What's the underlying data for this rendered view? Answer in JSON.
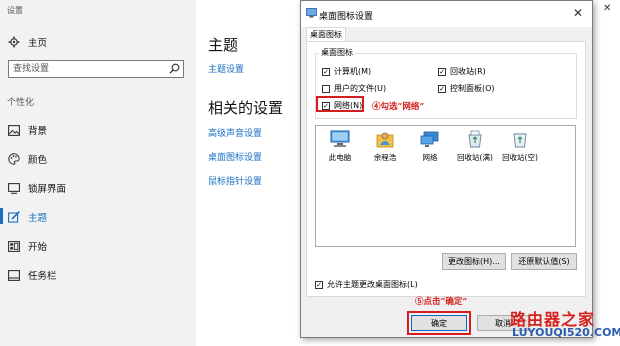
{
  "settings": {
    "window_title": "设置",
    "home": "主页",
    "search_placeholder": "查找设置",
    "section": "个性化",
    "nav": [
      "背景",
      "颜色",
      "锁屏界面",
      "主题",
      "开始",
      "任务栏"
    ],
    "active_index": 3,
    "main_title": "主题",
    "theme_settings_link": "主题设置",
    "related_title": "相关的设置",
    "related_links": [
      "高级声音设置",
      "桌面图标设置",
      "鼠标指针设置"
    ],
    "window_controls": [
      "—",
      "☐",
      "✕"
    ]
  },
  "dialog": {
    "title": "桌面图标设置",
    "close": "✕",
    "tab": "桌面图标",
    "group_label": "桌面图标",
    "checkboxes": [
      {
        "label": "计算机(M)",
        "checked": true
      },
      {
        "label": "回收站(R)",
        "checked": true
      },
      {
        "label": "用户的文件(U)",
        "checked": false
      },
      {
        "label": "控制面板(O)",
        "checked": true
      },
      {
        "label": "网络(N)",
        "checked": true
      }
    ],
    "icons": [
      {
        "label": "此电脑",
        "icon": "computer-icon"
      },
      {
        "label": "余程浩",
        "icon": "user-folder-icon"
      },
      {
        "label": "网络",
        "icon": "network-icon"
      },
      {
        "label": "回收站(满)",
        "icon": "recycle-bin-full-icon"
      },
      {
        "label": "回收站(空)",
        "icon": "recycle-bin-empty-icon"
      }
    ],
    "change_icon_button": "更改图标(H)...",
    "restore_default_button": "还原默认值(S)",
    "allow_theme_change": {
      "label": "允许主题更改桌面图标(L)",
      "checked": true
    },
    "ok_button": "确定",
    "cancel_button": "取消"
  },
  "annotations": {
    "step4": "④勾选“网络”",
    "step5": "⑤点击“确定”"
  },
  "watermark": {
    "line1": "路由器之家",
    "line2": "LUYOUQI520.COM"
  },
  "colors": {
    "accent": "#1a6fc2",
    "annotation": "#d61d1d"
  }
}
